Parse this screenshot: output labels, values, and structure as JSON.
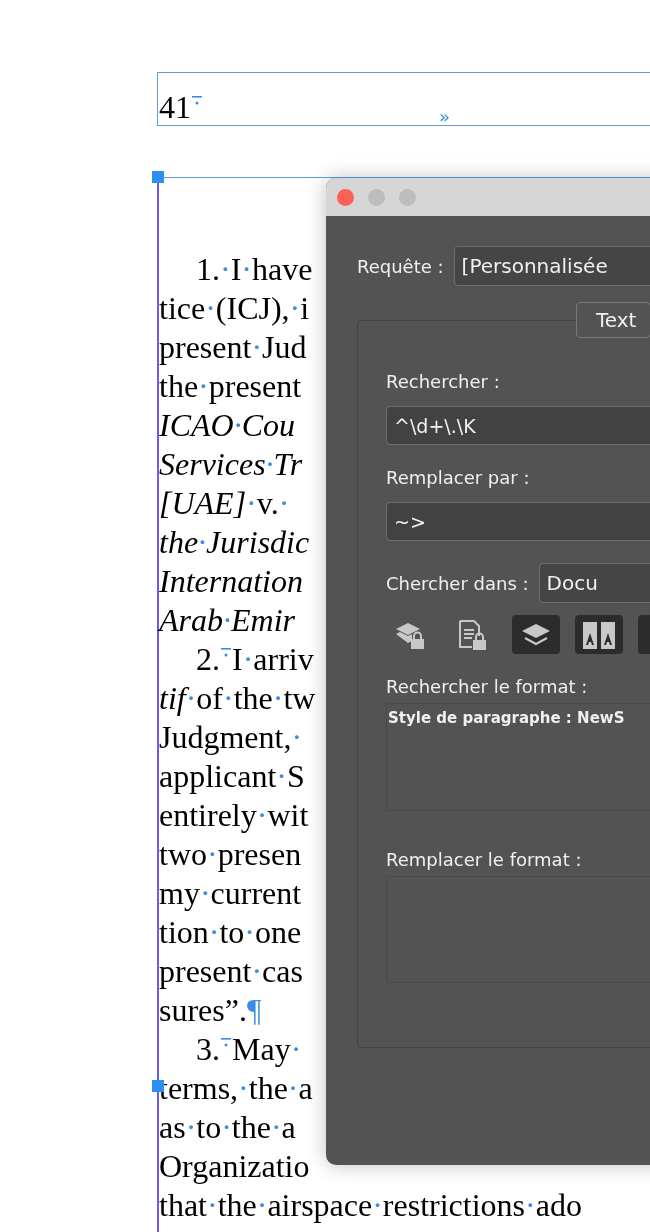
{
  "header_frame": {
    "text": "41",
    "marker": true,
    "overflow_mark": "»"
  },
  "document_lines": [
    {
      "kind": "first",
      "number": "1.",
      "marker": false,
      "text": "·I·have"
    },
    {
      "kind": "cont",
      "text": "tice·(ICJ),·i"
    },
    {
      "kind": "cont",
      "text": "present·Jud"
    },
    {
      "kind": "cont",
      "text": "the·present"
    },
    {
      "kind": "cont",
      "text": "*ICAO·Cou*"
    },
    {
      "kind": "cont",
      "text": "*Services·Tr*"
    },
    {
      "kind": "cont",
      "text": "*[UAE]*·v.·"
    },
    {
      "kind": "cont",
      "text": "*the·Jurisdic*"
    },
    {
      "kind": "cont",
      "text": "*Internation*"
    },
    {
      "kind": "cont",
      "text": "*Arab·Emir*"
    },
    {
      "kind": "first",
      "number": "2.",
      "marker": true,
      "text": "I·arriv"
    },
    {
      "kind": "cont",
      "text": "*tif*·of·the·tw"
    },
    {
      "kind": "cont",
      "text": "Judgment,·"
    },
    {
      "kind": "cont",
      "text": "applicant·S"
    },
    {
      "kind": "cont",
      "text": "entirely·wit"
    },
    {
      "kind": "cont",
      "text": "two·presen"
    },
    {
      "kind": "cont",
      "text": "my·current"
    },
    {
      "kind": "cont",
      "text": "tion·to·one"
    },
    {
      "kind": "cont",
      "text": "present·cas"
    },
    {
      "kind": "cont",
      "text": "sures”.¶"
    },
    {
      "kind": "first",
      "number": "3.",
      "marker": true,
      "text": "May·"
    },
    {
      "kind": "cont",
      "text": "terms,·the·a"
    },
    {
      "kind": "cont",
      "text": "as·to·the·a"
    },
    {
      "kind": "cont",
      "text": "Organizatio"
    },
    {
      "kind": "cont",
      "text": "that·the·airspace·restrictions·ado"
    }
  ],
  "dialog": {
    "query": {
      "label": "Requête :",
      "value": "[Personnalisée"
    },
    "tabs": [
      {
        "label": "Text",
        "selected": true
      }
    ],
    "find": {
      "label": "Rechercher :",
      "value": "^\\d+\\.\\K"
    },
    "replace": {
      "label": "Remplacer par :",
      "value": "~>"
    },
    "search_in": {
      "label": "Chercher dans :",
      "value": "Docu"
    },
    "toggles": [
      {
        "kind": "layer-lock",
        "selected": false
      },
      {
        "kind": "page-lock",
        "selected": false
      },
      {
        "kind": "layers",
        "selected": true
      },
      {
        "kind": "pages",
        "selected": true
      },
      {
        "kind": "other",
        "selected": true
      }
    ],
    "find_format": {
      "label": "Rechercher le format :",
      "value": "Style de paragraphe : NewS"
    },
    "replace_format": {
      "label": "Remplacer le format :"
    }
  }
}
